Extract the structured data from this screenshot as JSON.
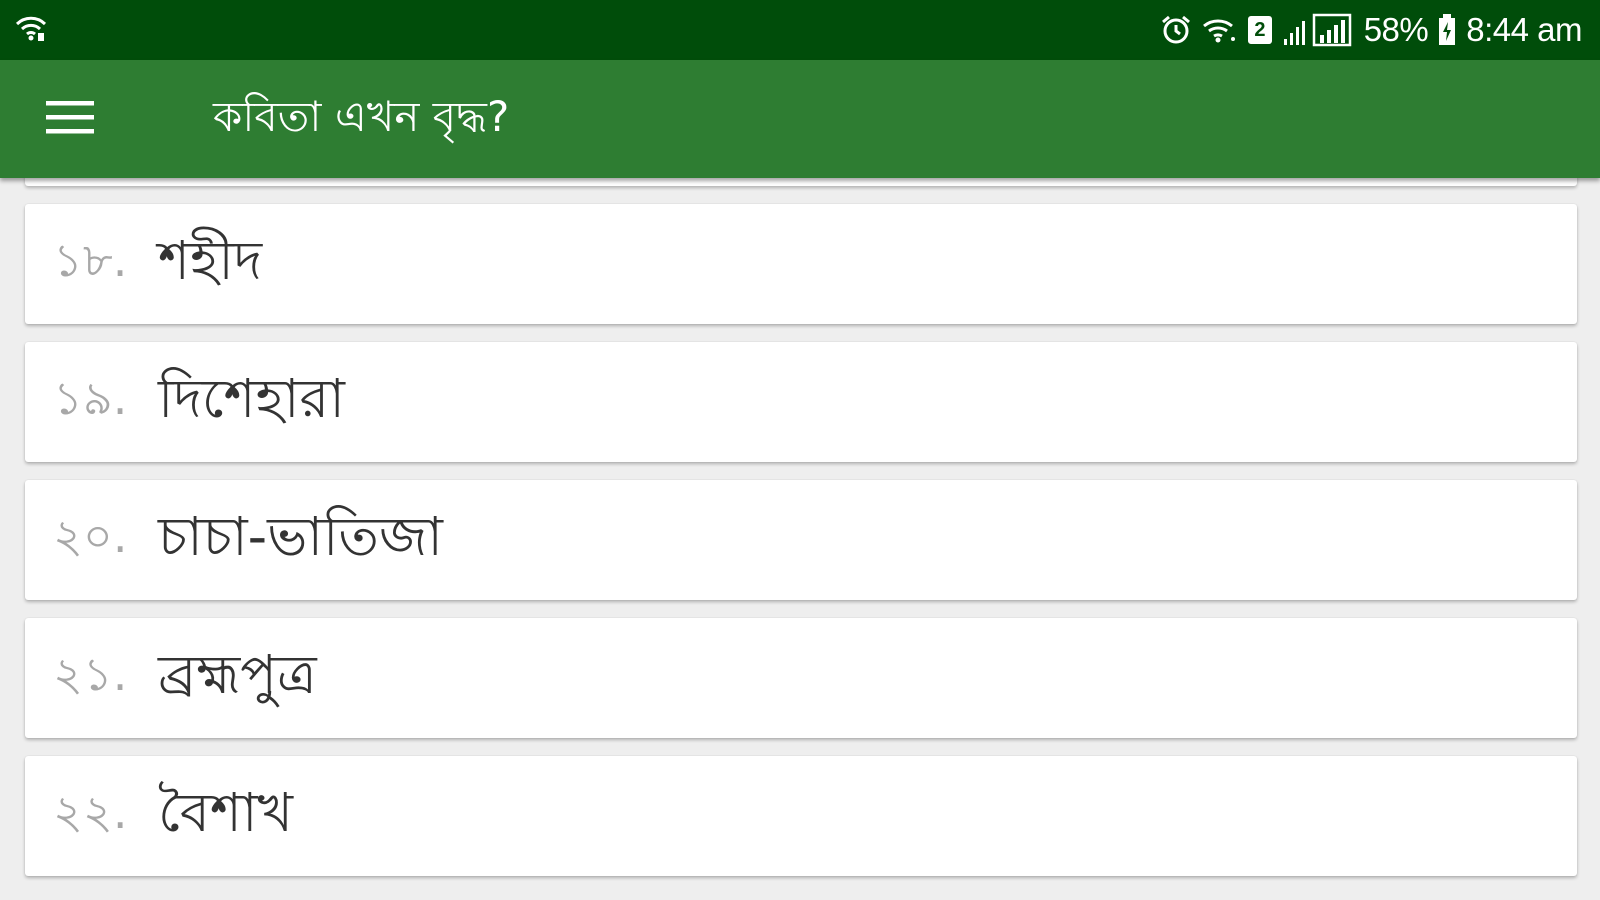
{
  "status_bar": {
    "battery_percent": "58%",
    "time": "8:44 am",
    "sim_slot": "2",
    "icons": [
      "wifi-calling-icon",
      "alarm-icon",
      "wifi-icon",
      "sim-2-icon",
      "signal-icon",
      "battery-icon"
    ]
  },
  "app_bar": {
    "menu_icon": "hamburger-menu-icon",
    "title": "কবিতা এখন বৃদ্ধ?"
  },
  "poems": [
    {
      "number": "১৮.",
      "title": "শহীদ"
    },
    {
      "number": "১৯.",
      "title": "দিশেহারা"
    },
    {
      "number": "২০.",
      "title": "চাচা-ভাতিজা"
    },
    {
      "number": "২১.",
      "title": "ব্রহ্মপুত্র"
    },
    {
      "number": "২২.",
      "title": "বৈশাখ"
    }
  ],
  "colors": {
    "status_bar": "#004d0a",
    "app_bar": "#2e7d32",
    "background": "#eeeeee",
    "card": "#ffffff",
    "number_text": "#a8a8a8",
    "title_text": "#333333"
  }
}
